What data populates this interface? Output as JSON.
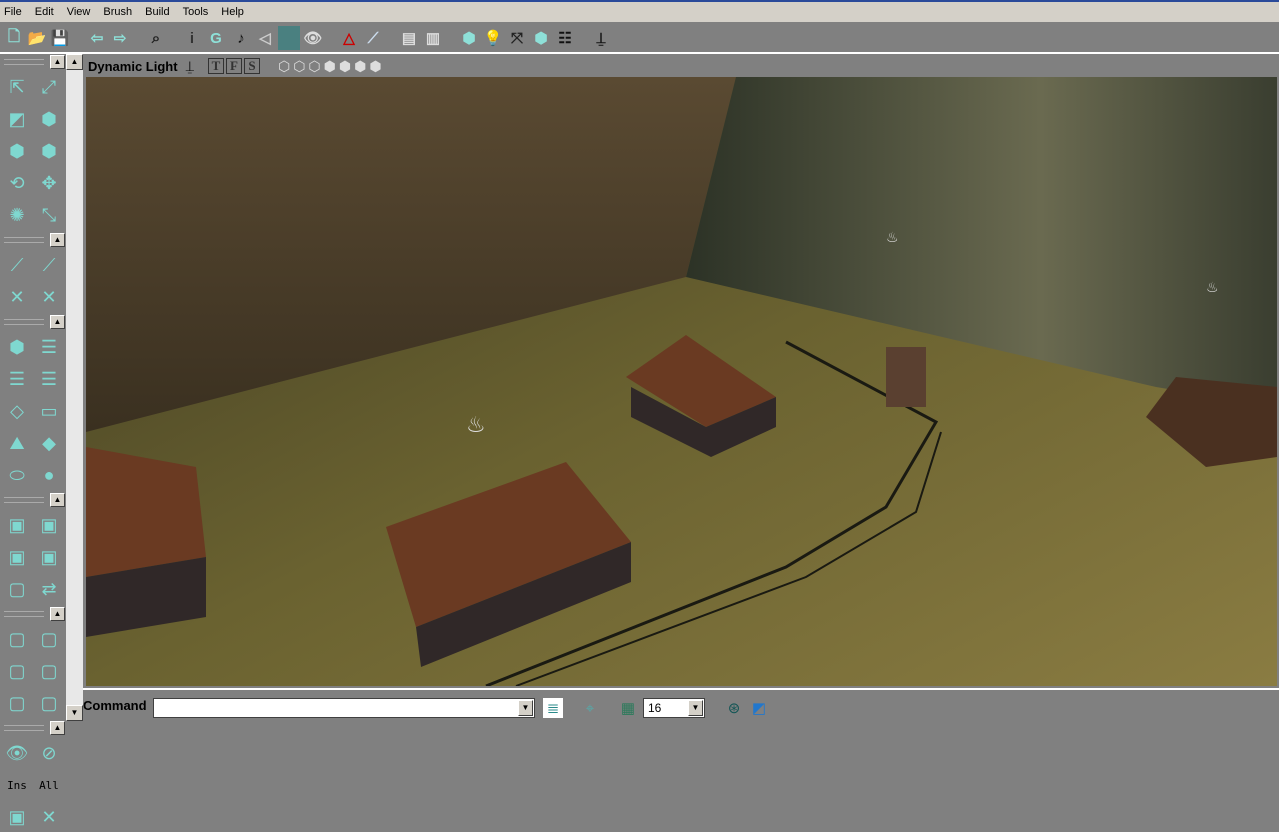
{
  "menu": [
    "File",
    "Edit",
    "View",
    "Brush",
    "Build",
    "Tools",
    "Help"
  ],
  "toolbar": {
    "icons": [
      "new-icon",
      "open-icon",
      "save-icon",
      "undo-icon",
      "redo-icon",
      "find-icon",
      "actor-properties-icon",
      "group-browser-icon",
      "music-browser-icon",
      "sound-browser-icon",
      "texture-browser-icon",
      "mesh-viewer-icon",
      "2d-shape-editor-icon",
      "brush-clip-icon",
      "actor-class-icon",
      "surface-properties-icon",
      "build-geometry-icon",
      "build-lighting-icon",
      "build-paths-icon",
      "build-all-icon",
      "build-options-icon",
      "play-level-icon"
    ]
  },
  "viewport": {
    "title": "Dynamic Light",
    "flags": [
      "T",
      "F",
      "S"
    ]
  },
  "command": {
    "label": "Command",
    "value": ""
  },
  "grid": {
    "size": "16"
  },
  "left_tools": [
    "camera-move",
    "scale",
    "texture-pan",
    "texture-rotate",
    "brush-clip",
    "vertex-edit",
    "rotate",
    "transform",
    "terrain",
    "cube",
    "stairs",
    "curved-stairs",
    "spiral-stairs",
    "sheet",
    "cone",
    "cylinder",
    "tetrahedron",
    "sphere",
    "add",
    "subtract",
    "intersect",
    "deintersect",
    "mover",
    "special-brush",
    "show-selected",
    "hide-selected",
    "select-inside",
    "select-all",
    "volume",
    "hide-actors"
  ],
  "left_text": {
    "ins": "Ins",
    "all": "All"
  },
  "colors": {
    "bg": "#808080",
    "menu": "#d4d0c8",
    "accent": "#7fd8d0"
  }
}
